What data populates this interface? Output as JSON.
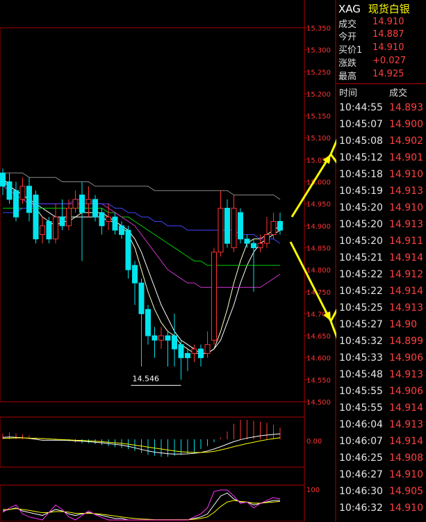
{
  "quote": {
    "symbol": "XAG",
    "name": "现货白银",
    "rows": [
      {
        "label": "成交",
        "value": "14.910"
      },
      {
        "label": "今开",
        "value": "14.887"
      },
      {
        "label": "买价1",
        "value": "14.910"
      },
      {
        "label": "涨跌",
        "value": "+0.027"
      },
      {
        "label": "最高",
        "value": "14.925"
      }
    ]
  },
  "ticks": {
    "header_time": "时间",
    "header_price": "成交",
    "rows": [
      {
        "time": "10:44:55",
        "price": "14.893"
      },
      {
        "time": "10:45:07",
        "price": "14.900"
      },
      {
        "time": "10:45:08",
        "price": "14.902"
      },
      {
        "time": "10:45:12",
        "price": "14.901"
      },
      {
        "time": "10:45:18",
        "price": "14.910"
      },
      {
        "time": "10:45:19",
        "price": "14.913"
      },
      {
        "time": "10:45:20",
        "price": "14.910"
      },
      {
        "time": "10:45:20",
        "price": "14.913"
      },
      {
        "time": "10:45:20",
        "price": "14.911"
      },
      {
        "time": "10:45:21",
        "price": "14.914"
      },
      {
        "time": "10:45:22",
        "price": "14.912"
      },
      {
        "time": "10:45:22",
        "price": "14.914"
      },
      {
        "time": "10:45:25",
        "price": "14.913"
      },
      {
        "time": "10:45:27",
        "price": "14.90"
      },
      {
        "time": "10:45:32",
        "price": "14.899"
      },
      {
        "time": "10:45:33",
        "price": "14.906"
      },
      {
        "time": "10:45:48",
        "price": "14.913"
      },
      {
        "time": "10:45:55",
        "price": "14.906"
      },
      {
        "time": "10:45:55",
        "price": "14.914"
      },
      {
        "time": "10:46:04",
        "price": "14.913"
      },
      {
        "time": "10:46:07",
        "price": "14.914"
      },
      {
        "time": "10:46:25",
        "price": "14.908"
      },
      {
        "time": "10:46:27",
        "price": "14.910"
      },
      {
        "time": "10:46:30",
        "price": "14.905"
      },
      {
        "time": "10:46:32",
        "price": "14.910"
      }
    ]
  },
  "colors": {
    "up": "#ff3333",
    "down": "#00e5ee",
    "grid": "#b00000",
    "arrow": "#ffff00"
  },
  "chart_data": {
    "type": "candlestick",
    "ylim": [
      14.5,
      15.35
    ],
    "yticks": [
      "15.350",
      "15.300",
      "15.250",
      "15.200",
      "15.150",
      "15.100",
      "15.050",
      "15.000",
      "14.950",
      "14.900",
      "14.850",
      "14.800",
      "14.750",
      "14.700",
      "14.650",
      "14.600",
      "14.550",
      "14.500"
    ],
    "low_annotation": "14.546",
    "candles": [
      {
        "o": 15.02,
        "c": 14.99,
        "h": 15.03,
        "l": 14.97
      },
      {
        "o": 15.0,
        "c": 14.96,
        "h": 15.02,
        "l": 14.95
      },
      {
        "o": 14.98,
        "c": 14.92,
        "h": 15.0,
        "l": 14.91
      },
      {
        "o": 14.96,
        "c": 14.99,
        "h": 15.01,
        "l": 14.95
      },
      {
        "o": 14.99,
        "c": 14.93,
        "h": 15.01,
        "l": 14.91
      },
      {
        "o": 14.97,
        "c": 14.87,
        "h": 14.98,
        "l": 14.86
      },
      {
        "o": 14.88,
        "c": 14.9,
        "h": 14.92,
        "l": 14.86
      },
      {
        "o": 14.91,
        "c": 14.87,
        "h": 14.92,
        "l": 14.86
      },
      {
        "o": 14.87,
        "c": 14.92,
        "h": 14.95,
        "l": 14.86
      },
      {
        "o": 14.92,
        "c": 14.9,
        "h": 14.96,
        "l": 14.89
      },
      {
        "o": 14.9,
        "c": 14.94,
        "h": 14.96,
        "l": 14.89
      },
      {
        "o": 14.94,
        "c": 14.96,
        "h": 14.98,
        "l": 14.93
      },
      {
        "o": 14.97,
        "c": 14.93,
        "h": 15.0,
        "l": 14.82
      },
      {
        "o": 14.95,
        "c": 14.96,
        "h": 14.99,
        "l": 14.92
      },
      {
        "o": 14.96,
        "c": 14.92,
        "h": 14.97,
        "l": 14.91
      },
      {
        "o": 14.93,
        "c": 14.9,
        "h": 14.94,
        "l": 14.88
      },
      {
        "o": 14.91,
        "c": 14.92,
        "h": 14.95,
        "l": 14.89
      },
      {
        "o": 14.92,
        "c": 14.89,
        "h": 14.93,
        "l": 14.88
      },
      {
        "o": 14.9,
        "c": 14.88,
        "h": 14.91,
        "l": 14.87
      },
      {
        "o": 14.89,
        "c": 14.8,
        "h": 14.9,
        "l": 14.78
      },
      {
        "o": 14.81,
        "c": 14.77,
        "h": 14.82,
        "l": 14.72
      },
      {
        "o": 14.77,
        "c": 14.7,
        "h": 14.78,
        "l": 14.58
      },
      {
        "o": 14.71,
        "c": 14.65,
        "h": 14.72,
        "l": 14.63
      },
      {
        "o": 14.65,
        "c": 14.64,
        "h": 14.67,
        "l": 14.6
      },
      {
        "o": 14.64,
        "c": 14.65,
        "h": 14.67,
        "l": 14.62
      },
      {
        "o": 14.65,
        "c": 14.64,
        "h": 14.66,
        "l": 14.58
      },
      {
        "o": 14.65,
        "c": 14.62,
        "h": 14.7,
        "l": 14.58
      },
      {
        "o": 14.63,
        "c": 14.6,
        "h": 14.64,
        "l": 14.55
      },
      {
        "o": 14.61,
        "c": 14.6,
        "h": 14.62,
        "l": 14.57
      },
      {
        "o": 14.61,
        "c": 14.62,
        "h": 14.63,
        "l": 14.59
      },
      {
        "o": 14.62,
        "c": 14.6,
        "h": 14.63,
        "l": 14.58
      },
      {
        "o": 14.61,
        "c": 14.63,
        "h": 14.66,
        "l": 14.6
      },
      {
        "o": 14.64,
        "c": 14.84,
        "h": 14.85,
        "l": 14.63
      },
      {
        "o": 14.84,
        "c": 14.94,
        "h": 14.98,
        "l": 14.83
      },
      {
        "o": 14.94,
        "c": 14.86,
        "h": 14.96,
        "l": 14.85
      },
      {
        "o": 14.85,
        "c": 14.94,
        "h": 14.97,
        "l": 14.84
      },
      {
        "o": 14.93,
        "c": 14.87,
        "h": 14.94,
        "l": 14.86
      },
      {
        "o": 14.87,
        "c": 14.86,
        "h": 14.88,
        "l": 14.85
      },
      {
        "o": 14.86,
        "c": 14.85,
        "h": 14.87,
        "l": 14.75
      },
      {
        "o": 14.85,
        "c": 14.86,
        "h": 14.88,
        "l": 14.84
      },
      {
        "o": 14.86,
        "c": 14.88,
        "h": 14.92,
        "l": 14.85
      },
      {
        "o": 14.88,
        "c": 14.91,
        "h": 14.93,
        "l": 14.87
      },
      {
        "o": 14.91,
        "c": 14.89,
        "h": 14.93,
        "l": 14.88
      }
    ],
    "ma_series": [
      {
        "color": "#ffffcc",
        "values": [
          15.01,
          14.99,
          14.98,
          14.97,
          14.96,
          14.94,
          14.92,
          14.91,
          14.9,
          14.91,
          14.91,
          14.92,
          14.93,
          14.93,
          14.93,
          14.93,
          14.92,
          14.91,
          14.9,
          14.88,
          14.85,
          14.8,
          14.75,
          14.71,
          14.68,
          14.66,
          14.65,
          14.63,
          14.62,
          14.61,
          14.61,
          14.61,
          14.62,
          14.66,
          14.71,
          14.77,
          14.82,
          14.86,
          14.87,
          14.87,
          14.88,
          14.89,
          14.9
        ]
      },
      {
        "color": "#ffffff",
        "values": [
          15.0,
          14.99,
          14.98,
          14.97,
          14.96,
          14.95,
          14.94,
          14.93,
          14.92,
          14.92,
          14.92,
          14.92,
          14.92,
          14.92,
          14.92,
          14.92,
          14.91,
          14.91,
          14.9,
          14.89,
          14.87,
          14.84,
          14.8,
          14.76,
          14.72,
          14.69,
          14.66,
          14.64,
          14.63,
          14.62,
          14.61,
          14.61,
          14.62,
          14.64,
          14.68,
          14.72,
          14.77,
          14.81,
          14.84,
          14.86,
          14.87,
          14.88,
          14.89
        ]
      },
      {
        "color": "#00cc00",
        "values": [
          14.94,
          14.94,
          14.94,
          14.94,
          14.94,
          14.94,
          14.94,
          14.94,
          14.94,
          14.94,
          14.94,
          14.94,
          14.94,
          14.94,
          14.94,
          14.94,
          14.93,
          14.93,
          14.92,
          14.92,
          14.91,
          14.9,
          14.89,
          14.88,
          14.87,
          14.86,
          14.85,
          14.84,
          14.83,
          14.82,
          14.82,
          14.81,
          14.81,
          14.81,
          14.81,
          14.81,
          14.81,
          14.81,
          14.81,
          14.81,
          14.81,
          14.81,
          14.81
        ]
      },
      {
        "color": "#cc33cc",
        "values": [
          14.99,
          14.98,
          14.97,
          14.96,
          14.95,
          14.95,
          14.95,
          14.95,
          14.95,
          14.95,
          14.95,
          14.95,
          14.95,
          14.95,
          14.95,
          14.95,
          14.94,
          14.93,
          14.92,
          14.91,
          14.9,
          14.88,
          14.86,
          14.84,
          14.82,
          14.8,
          14.79,
          14.78,
          14.77,
          14.77,
          14.76,
          14.76,
          14.76,
          14.76,
          14.76,
          14.76,
          14.76,
          14.76,
          14.76,
          14.76,
          14.77,
          14.78,
          14.79
        ]
      },
      {
        "color": "#4444ff",
        "values": [
          14.93,
          14.93,
          14.93,
          14.94,
          14.94,
          14.95,
          14.95,
          14.95,
          14.95,
          14.95,
          14.95,
          14.96,
          14.96,
          14.96,
          14.95,
          14.95,
          14.95,
          14.94,
          14.94,
          14.93,
          14.93,
          14.92,
          14.92,
          14.91,
          14.91,
          14.9,
          14.9,
          14.9,
          14.89,
          14.89,
          14.89,
          14.89,
          14.89,
          14.89,
          14.89,
          14.89,
          14.88,
          14.88,
          14.88,
          14.87,
          14.87,
          14.87,
          14.86
        ]
      },
      {
        "color": "#888888",
        "values": [
          15.02,
          15.02,
          15.02,
          15.02,
          15.01,
          15.01,
          15.01,
          15.01,
          15.01,
          15.0,
          15.0,
          15.0,
          15.0,
          15.0,
          14.99,
          14.99,
          14.99,
          14.99,
          14.99,
          14.99,
          14.99,
          14.99,
          14.99,
          14.98,
          14.98,
          14.98,
          14.98,
          14.98,
          14.98,
          14.98,
          14.98,
          14.98,
          14.98,
          14.98,
          14.98,
          14.97,
          14.97,
          14.97,
          14.97,
          14.97,
          14.97,
          14.97,
          14.96
        ]
      }
    ],
    "macd": {
      "zero_label": "0.00",
      "hist": [
        0.3,
        0.35,
        0.3,
        0.25,
        0.2,
        0.1,
        0.05,
        0.0,
        -0.05,
        -0.05,
        -0.1,
        -0.15,
        -0.2,
        -0.2,
        -0.25,
        -0.3,
        -0.35,
        -0.4,
        -0.45,
        -0.5,
        -0.6,
        -0.7,
        -0.8,
        -0.85,
        -0.9,
        -0.9,
        -0.85,
        -0.8,
        -0.75,
        -0.65,
        -0.5,
        -0.35,
        -0.15,
        0.1,
        0.4,
        0.8,
        1.0,
        1.0,
        0.95,
        0.9,
        0.85,
        0.75,
        0.6
      ],
      "dif": [
        0.1,
        0.12,
        0.1,
        0.08,
        0.05,
        0.0,
        -0.05,
        -0.05,
        -0.05,
        -0.05,
        -0.06,
        -0.08,
        -0.1,
        -0.12,
        -0.15,
        -0.18,
        -0.22,
        -0.26,
        -0.3,
        -0.36,
        -0.44,
        -0.52,
        -0.6,
        -0.66,
        -0.7,
        -0.74,
        -0.76,
        -0.76,
        -0.75,
        -0.72,
        -0.68,
        -0.6,
        -0.5,
        -0.38,
        -0.25,
        -0.12,
        -0.02,
        0.06,
        0.12,
        0.18,
        0.22,
        0.25,
        0.28
      ],
      "dea": [
        0.05,
        0.06,
        0.07,
        0.07,
        0.06,
        0.05,
        0.04,
        0.02,
        0.0,
        -0.02,
        -0.03,
        -0.05,
        -0.06,
        -0.08,
        -0.1,
        -0.12,
        -0.15,
        -0.18,
        -0.21,
        -0.25,
        -0.3,
        -0.35,
        -0.4,
        -0.45,
        -0.5,
        -0.55,
        -0.6,
        -0.64,
        -0.66,
        -0.68,
        -0.68,
        -0.66,
        -0.62,
        -0.55,
        -0.47,
        -0.38,
        -0.3,
        -0.22,
        -0.15,
        -0.08,
        -0.02,
        0.03,
        0.08
      ]
    },
    "kdj": {
      "top_label": "100",
      "k": [
        30,
        35,
        40,
        30,
        25,
        20,
        15,
        25,
        35,
        30,
        20,
        15,
        20,
        25,
        20,
        15,
        10,
        5,
        5,
        0,
        0,
        0,
        0,
        0,
        0,
        0,
        0,
        0,
        0,
        5,
        10,
        20,
        50,
        80,
        90,
        70,
        60,
        60,
        50,
        55,
        60,
        65,
        65
      ],
      "d": [
        35,
        35,
        38,
        35,
        32,
        28,
        24,
        25,
        28,
        28,
        26,
        22,
        22,
        22,
        21,
        19,
        16,
        13,
        10,
        7,
        5,
        3,
        2,
        1,
        1,
        1,
        1,
        1,
        1,
        2,
        5,
        10,
        25,
        45,
        60,
        65,
        62,
        60,
        56,
        56,
        58,
        60,
        62
      ],
      "j": [
        25,
        40,
        50,
        20,
        10,
        5,
        0,
        25,
        50,
        35,
        10,
        0,
        15,
        30,
        18,
        8,
        0,
        0,
        0,
        0,
        0,
        0,
        0,
        0,
        0,
        0,
        0,
        0,
        0,
        10,
        20,
        40,
        95,
        100,
        100,
        80,
        55,
        60,
        40,
        55,
        65,
        75,
        70
      ]
    }
  }
}
